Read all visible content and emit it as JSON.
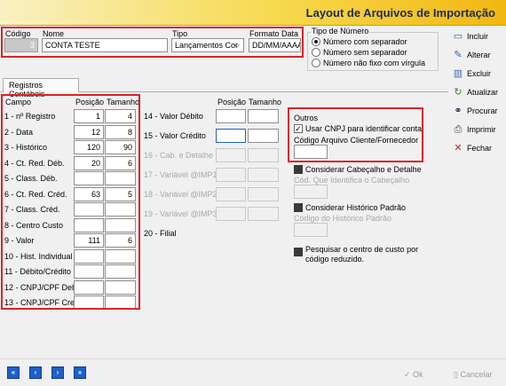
{
  "window": {
    "title": "Layout de Arquivos de Importação"
  },
  "header": {
    "codigo_label": "Código",
    "codigo_value": "3",
    "nome_label": "Nome",
    "nome_value": "CONTA TESTE",
    "tipo_label": "Tipo",
    "tipo_value": "Lançamentos Cor",
    "formato_label": "Formato Data",
    "formato_value": "DD/MM/AAAA"
  },
  "tipo_numero": {
    "title": "Tipo de Número",
    "options": [
      {
        "label": "Número com separador",
        "selected": true
      },
      {
        "label": "Número sem separador",
        "selected": false
      },
      {
        "label": "Número não fixo com vírgula",
        "selected": false
      }
    ]
  },
  "toolbar": {
    "incluir": "Incluir",
    "alterar": "Alterar",
    "excluir": "Excluir",
    "atualizar": "Atualizar",
    "procurar": "Procurar",
    "imprimir": "Imprimir",
    "fechar": "Fechar"
  },
  "tabs": {
    "registros": "Registros Contábeis"
  },
  "columns": {
    "campo": "Campo",
    "posicao": "Posição",
    "tamanho": "Tamanho"
  },
  "fields_left": [
    {
      "label": "1 - nº Registro",
      "pos": "1",
      "tam": "4"
    },
    {
      "label": "2 - Data",
      "pos": "12",
      "tam": "8"
    },
    {
      "label": "3 - Histórico",
      "pos": "120",
      "tam": "90"
    },
    {
      "label": "4 - Ct. Red. Déb.",
      "pos": "20",
      "tam": "6"
    },
    {
      "label": "5 - Class. Déb.",
      "pos": "",
      "tam": ""
    },
    {
      "label": "6 - Ct. Red. Créd.",
      "pos": "63",
      "tam": "5"
    },
    {
      "label": "7 - Class. Créd.",
      "pos": "",
      "tam": ""
    },
    {
      "label": "8 - Centro Custo",
      "pos": "",
      "tam": ""
    },
    {
      "label": "9 - Valor",
      "pos": "111",
      "tam": "6"
    },
    {
      "label": "10 - Hist. Individual",
      "pos": "",
      "tam": ""
    },
    {
      "label": "11 - Débito/Crédito",
      "pos": "",
      "tam": ""
    },
    {
      "label": "12 - CNPJ/CPF Deb.",
      "pos": "",
      "tam": ""
    },
    {
      "label": "13 - CNPJ/CPF Cred.",
      "pos": "",
      "tam": ""
    }
  ],
  "fields_right": [
    {
      "label": "14 - Valor Débito",
      "disabled": false
    },
    {
      "label": "15 - Valor Crédito",
      "disabled": false
    },
    {
      "label": "16 - Cab. e Detalhe",
      "disabled": true
    },
    {
      "label": "17 - Variável @IMP1",
      "disabled": true
    },
    {
      "label": "18 - Variável @IMP2",
      "disabled": true
    },
    {
      "label": "19 - Variável @IMP3",
      "disabled": true
    },
    {
      "label": "20 - Filial",
      "disabled": false
    }
  ],
  "outros": {
    "title": "Outros",
    "usar_cnpj": "Usar CNPJ para identificar conta",
    "codigo_arquivo": "Código Arquivo Cliente/Fornecedor",
    "considerar_cab": "Considerar Cabeçalho e Detalhe",
    "cod_cab": "Cód. Que Identifica o Cabeçalho",
    "considerar_hist": "Considerar Histórico Padrão",
    "codigo_hist": "Código do Histórico Padrão",
    "pesquisar_line1": "Pesquisar o centro de custo por",
    "pesquisar_line2": "código reduzido."
  },
  "footer": {
    "ok": "Ok",
    "cancelar": "Cancelar"
  }
}
